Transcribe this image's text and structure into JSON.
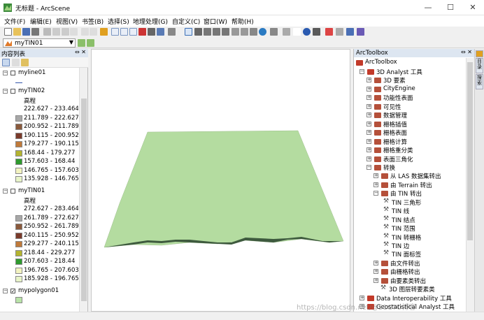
{
  "window": {
    "title": "无标题 - ArcScene"
  },
  "menu": [
    "文件(F)",
    "编辑(E)",
    "视图(V)",
    "书签(B)",
    "选择(S)",
    "地理处理(G)",
    "自定义(C)",
    "窗口(W)",
    "帮助(H)"
  ],
  "layer_select": {
    "value": "myTIN01"
  },
  "toc": {
    "title": "内容列表",
    "layers": [
      {
        "name": "myline01",
        "checked": false
      },
      {
        "name": "myTIN02",
        "checked": false,
        "heading": "高程",
        "classes": [
          {
            "label": "222.627 - 233.464",
            "color": ""
          },
          {
            "label": "211.789 - 222.627",
            "color": "#a8a8a8"
          },
          {
            "label": "200.952 - 211.789",
            "color": "#8a5a3c"
          },
          {
            "label": "190.115 - 200.952",
            "color": "#7a3a2a"
          },
          {
            "label": "179.277 - 190.115",
            "color": "#c07a3a"
          },
          {
            "label": "168.44 - 179.277",
            "color": "#b4b430"
          },
          {
            "label": "157.603 - 168.44",
            "color": "#2f9a2f"
          },
          {
            "label": "146.765 - 157.603",
            "color": "#f3f3c0"
          },
          {
            "label": "135.928 - 146.765",
            "color": "#e8f4c8"
          }
        ]
      },
      {
        "name": "myTIN01",
        "checked": false,
        "heading": "高程",
        "classes": [
          {
            "label": "272.627 - 283.464",
            "color": ""
          },
          {
            "label": "261.789 - 272.627",
            "color": "#a8a8a8"
          },
          {
            "label": "250.952 - 261.789",
            "color": "#8a5a3c"
          },
          {
            "label": "240.115 - 250.952",
            "color": "#7a3a2a"
          },
          {
            "label": "229.277 - 240.115",
            "color": "#c07a3a"
          },
          {
            "label": "218.44 - 229.277",
            "color": "#b4b430"
          },
          {
            "label": "207.603 - 218.44",
            "color": "#2f9a2f"
          },
          {
            "label": "196.765 - 207.603",
            "color": "#f3f3c0"
          },
          {
            "label": "185.928 - 196.765",
            "color": "#e8f4c8"
          }
        ]
      },
      {
        "name": "mypolygon01",
        "checked": true,
        "fill": "#b9e3a8"
      }
    ]
  },
  "scene": {
    "surface_color": "#b4dca0",
    "edge_color": "#3e5a3e",
    "background": "#ffffff"
  },
  "toolbox": {
    "title": "ArcToolbox",
    "root": "ArcToolbox",
    "items": [
      {
        "label": "3D Analyst 工具",
        "level": 1,
        "exp": "-"
      },
      {
        "label": "3D 要素",
        "level": 2,
        "exp": "+"
      },
      {
        "label": "CityEngine",
        "level": 2,
        "exp": "+"
      },
      {
        "label": "功能性表面",
        "level": 2,
        "exp": "+"
      },
      {
        "label": "可见性",
        "level": 2,
        "exp": "+"
      },
      {
        "label": "数据管理",
        "level": 2,
        "exp": "+"
      },
      {
        "label": "栅格插值",
        "level": 2,
        "exp": "+"
      },
      {
        "label": "栅格表面",
        "level": 2,
        "exp": "+"
      },
      {
        "label": "栅格计算",
        "level": 2,
        "exp": "+"
      },
      {
        "label": "栅格重分类",
        "level": 2,
        "exp": "+"
      },
      {
        "label": "表面三角化",
        "level": 2,
        "exp": "+"
      },
      {
        "label": "转换",
        "level": 2,
        "exp": "-"
      },
      {
        "label": "从 LAS 数据集转出",
        "level": 3,
        "exp": "+"
      },
      {
        "label": "由 Terrain 转出",
        "level": 3,
        "exp": "+"
      },
      {
        "label": "由 TIN 转出",
        "level": 3,
        "exp": "-"
      },
      {
        "label": "TIN 三角形",
        "level": 4,
        "exp": ""
      },
      {
        "label": "TIN 线",
        "level": 4,
        "exp": ""
      },
      {
        "label": "TIN 结点",
        "level": 4,
        "exp": ""
      },
      {
        "label": "TIN 范围",
        "level": 4,
        "exp": ""
      },
      {
        "label": "TIN 转栅格",
        "level": 4,
        "exp": ""
      },
      {
        "label": "TIN 边",
        "level": 4,
        "exp": ""
      },
      {
        "label": "TIN 面标签",
        "level": 4,
        "exp": ""
      },
      {
        "label": "由文件转出",
        "level": 3,
        "exp": "+"
      },
      {
        "label": "由栅格转出",
        "level": 3,
        "exp": "+"
      },
      {
        "label": "由要素类转出",
        "level": 3,
        "exp": "+"
      },
      {
        "label": "3D 图层转要素类",
        "level": 3,
        "exp": "",
        "tool": true
      },
      {
        "label": "Data Interoperability 工具",
        "level": 1,
        "exp": "+"
      },
      {
        "label": "Geostatistical Analyst 工具",
        "level": 1,
        "exp": "+"
      }
    ]
  },
  "side_tabs": [
    "目录",
    "搜索"
  ],
  "watermark": "https://blog.csdn.net/@51CTO博客"
}
